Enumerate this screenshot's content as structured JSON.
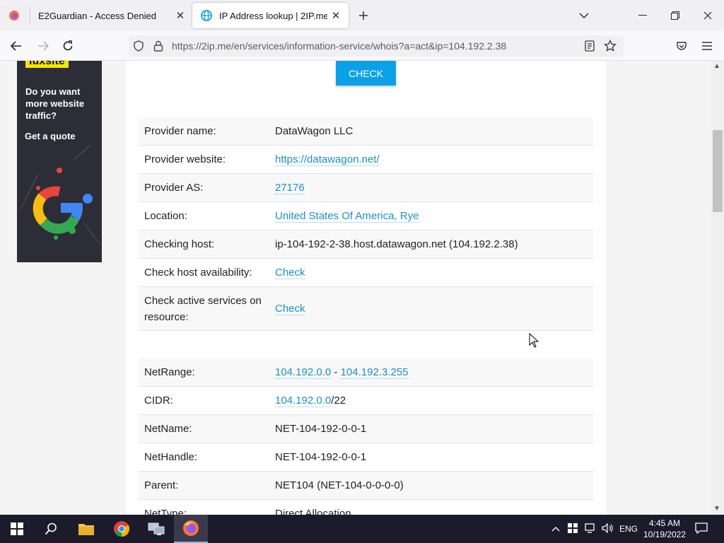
{
  "browser": {
    "tabs": [
      {
        "title": "E2Guardian - Access Denied",
        "active": false
      },
      {
        "title": "IP Address lookup | 2IP.me",
        "active": true
      }
    ],
    "url": "https://2ip.me/en/services/information-service/whois?a=act&ip=104.192.2.38"
  },
  "ad": {
    "brand": "luxsite",
    "text": "Do you want more website traffic?",
    "cta": "Get a quote"
  },
  "page": {
    "check_button": "CHECK",
    "provider_rows": [
      {
        "label": "Provider name:",
        "value": "DataWagon LLC",
        "link": false
      },
      {
        "label": "Provider website:",
        "value": "https://datawagon.net/",
        "link": true
      },
      {
        "label": "Provider AS:",
        "value": "27176",
        "link": true
      },
      {
        "label": "Location:",
        "value": "United States Of America, Rye",
        "link": true
      },
      {
        "label": "Checking host:",
        "value": "ip-104-192-2-38.host.datawagon.net (104.192.2.38)",
        "link": false
      },
      {
        "label": "Check host availability:",
        "value": "Check",
        "link": true
      },
      {
        "label": "Check active services on resource:",
        "value": "Check",
        "link": true
      }
    ],
    "netrange": {
      "label": "NetRange:",
      "start": "104.192.0.0",
      "sep": " - ",
      "end": "104.192.3.255"
    },
    "cidr": {
      "label": "CIDR:",
      "ip": "104.192.0.0",
      "suffix": "/22"
    },
    "whois_rows": [
      {
        "label": "NetName:",
        "value": "NET-104-192-0-0-1"
      },
      {
        "label": "NetHandle:",
        "value": "NET-104-192-0-0-1"
      },
      {
        "label": "Parent:",
        "value": "NET104 (NET-104-0-0-0-0)"
      },
      {
        "label": "NetType:",
        "value": "Direct Allocation"
      }
    ]
  },
  "taskbar": {
    "language": "ENG",
    "time": "4:45 AM",
    "date": "10/19/2022"
  }
}
